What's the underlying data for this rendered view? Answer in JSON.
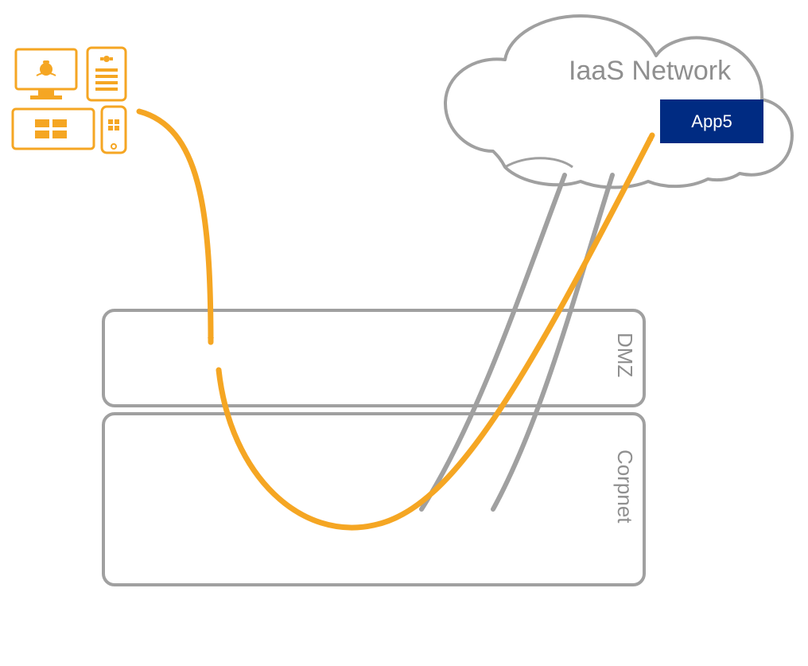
{
  "cloud": {
    "label": "IaaS Network"
  },
  "app": {
    "label": "App5"
  },
  "zones": {
    "dmz_label": "DMZ",
    "corpnet_label": "Corpnet"
  },
  "colors": {
    "orange": "#F5A623",
    "gray_line": "#A0A0A0",
    "gray_text": "#8f8f8f",
    "app_bg": "#002b82",
    "app_text": "#ffffff"
  }
}
